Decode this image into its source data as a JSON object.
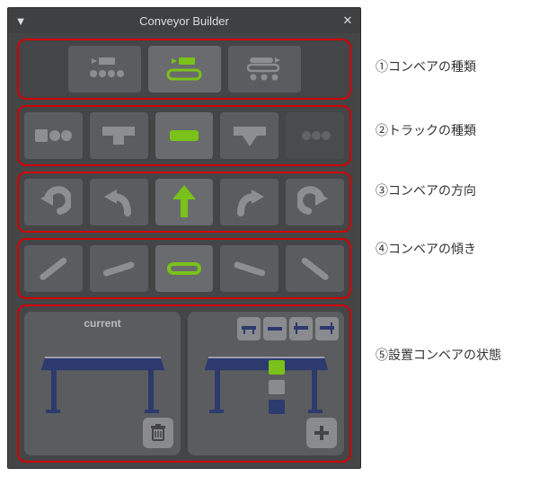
{
  "panel": {
    "title": "Conveyor Builder",
    "close_glyph": "✕",
    "collapse_glyph": "▼"
  },
  "row1": {
    "items": [
      {
        "name": "conveyor-type-roller"
      },
      {
        "name": "conveyor-type-belt",
        "active": true
      },
      {
        "name": "conveyor-type-accum"
      }
    ]
  },
  "row2": {
    "items": [
      {
        "name": "track-type-1"
      },
      {
        "name": "track-type-tee"
      },
      {
        "name": "track-type-straight",
        "active": true
      },
      {
        "name": "track-type-chute"
      },
      {
        "name": "track-type-dots",
        "dim": true
      }
    ]
  },
  "row3": {
    "items": [
      {
        "name": "direction-back-left"
      },
      {
        "name": "direction-left"
      },
      {
        "name": "direction-forward",
        "active": true
      },
      {
        "name": "direction-right"
      },
      {
        "name": "direction-back-right"
      }
    ]
  },
  "row4": {
    "items": [
      {
        "name": "incline-down-steep"
      },
      {
        "name": "incline-down"
      },
      {
        "name": "incline-flat",
        "active": true
      },
      {
        "name": "incline-up"
      },
      {
        "name": "incline-up-steep"
      }
    ]
  },
  "preview": {
    "current_label": "current",
    "mini": [
      {
        "name": "variant-1"
      },
      {
        "name": "variant-2"
      },
      {
        "name": "variant-3"
      },
      {
        "name": "variant-4"
      }
    ],
    "swatches": [
      {
        "name": "swatch-green",
        "color": "#7ac219"
      },
      {
        "name": "swatch-grey",
        "color": "#8a8b8e"
      },
      {
        "name": "swatch-blue",
        "color": "#2c3a6e"
      }
    ]
  },
  "annotations": {
    "a1": "①コンベアの種類",
    "a2": "②トラックの種類",
    "a3": "③コンベアの方向",
    "a4": "④コンベアの傾き",
    "a5": "⑤設置コンベアの状態"
  }
}
